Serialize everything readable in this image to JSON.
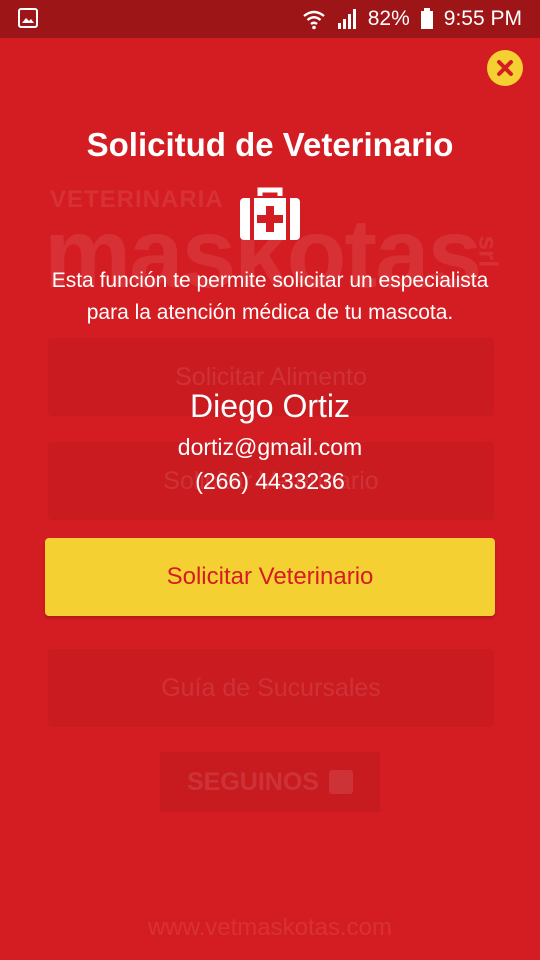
{
  "status_bar": {
    "battery": "82%",
    "time": "9:55 PM",
    "icons": [
      "image-icon",
      "wifi-icon",
      "signal-icon",
      "battery-icon"
    ]
  },
  "background": {
    "logo_top": "VETERINARIA",
    "logo_main": "maskotas",
    "logo_srl": "srl",
    "buttons": [
      {
        "label": "Solicitar Alimento",
        "icon": "truck-icon"
      },
      {
        "label": "Solicitar Veterinario",
        "icon": "medical-kit-icon"
      },
      {
        "label": "Guía de Sucursales",
        "icon": ""
      }
    ],
    "seguinos": "SEGUINOS",
    "url": "www.vetmaskotas.com"
  },
  "dialog": {
    "title": "Solicitud de Veterinario",
    "description_line1": "Esta función te permite solicitar un especialista",
    "description_line2": "para la atención médica de tu mascota.",
    "user_name": "Diego Ortiz",
    "user_email": "dortiz@gmail.com",
    "user_phone": "(266) 4433236",
    "cta_label": "Solicitar Veterinario",
    "close_icon": "close-icon",
    "header_icon": "medical-kit-icon"
  },
  "colors": {
    "background": "#d41d22",
    "status_bar": "#9e1518",
    "accent_yellow": "#f5d032"
  }
}
